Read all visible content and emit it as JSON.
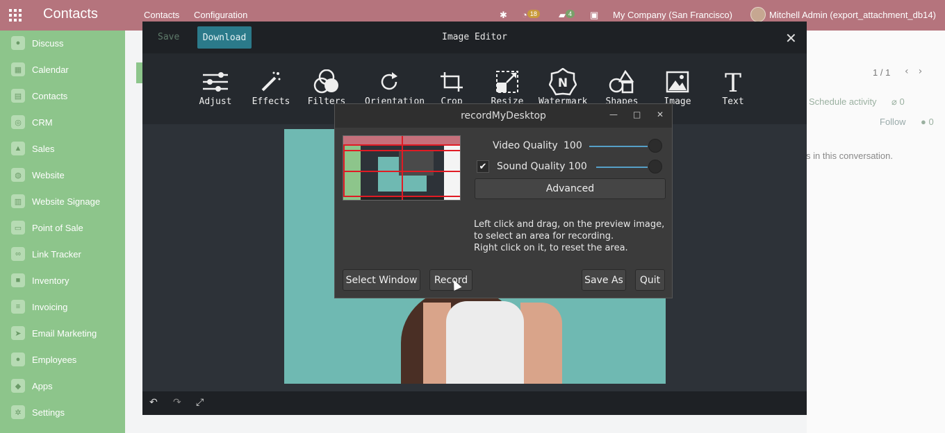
{
  "navbar": {
    "brand": "Contacts",
    "menu": [
      "Contacts",
      "Configuration"
    ],
    "activity_count": "18",
    "message_count": "4",
    "company": "My Company (San Francisco)",
    "user": "Mitchell Admin (export_attachment_db14)"
  },
  "sidebar": {
    "items": [
      {
        "label": "Discuss",
        "icon": "chat-icon"
      },
      {
        "label": "Calendar",
        "icon": "calendar-icon"
      },
      {
        "label": "Contacts",
        "icon": "contacts-icon"
      },
      {
        "label": "CRM",
        "icon": "crm-icon"
      },
      {
        "label": "Sales",
        "icon": "sales-icon"
      },
      {
        "label": "Website",
        "icon": "globe-icon"
      },
      {
        "label": "Website Signage",
        "icon": "signage-icon"
      },
      {
        "label": "Point of Sale",
        "icon": "pos-icon"
      },
      {
        "label": "Link Tracker",
        "icon": "link-icon"
      },
      {
        "label": "Inventory",
        "icon": "box-icon"
      },
      {
        "label": "Invoicing",
        "icon": "invoice-icon"
      },
      {
        "label": "Email Marketing",
        "icon": "send-icon"
      },
      {
        "label": "Employees",
        "icon": "people-icon"
      },
      {
        "label": "Apps",
        "icon": "apps-icon"
      },
      {
        "label": "Settings",
        "icon": "gear-icon"
      }
    ]
  },
  "background": {
    "pager": "1 / 1",
    "schedule_activity": "Schedule activity",
    "attachments": "0",
    "follow": "Follow",
    "followers": "0",
    "conversation_text": "s in this conversation."
  },
  "editor": {
    "save_label": "Save",
    "download_label": "Download",
    "title": "Image Editor",
    "tools": [
      {
        "label": "Adjust"
      },
      {
        "label": "Effects"
      },
      {
        "label": "Filters"
      },
      {
        "label": "Orientation"
      },
      {
        "label": "Crop"
      },
      {
        "label": "Resize"
      },
      {
        "label": "Watermark"
      },
      {
        "label": "Shapes"
      },
      {
        "label": "Image"
      },
      {
        "label": "Text"
      }
    ]
  },
  "rmd": {
    "title": "recordMyDesktop",
    "video_quality_label": "Video Quality",
    "video_quality_value": "100",
    "sound_quality_label": "Sound Quality",
    "sound_quality_value": "100",
    "sound_enabled": true,
    "advanced_label": "Advanced",
    "help_line1": "Left click and drag, on the preview image,",
    "help_line2": "to select an area for recording.",
    "help_line3": "Right click on it, to reset the area.",
    "select_window_label": "Select Window",
    "record_label": "Record",
    "save_as_label": "Save As",
    "quit_label": "Quit"
  },
  "colors": {
    "navbar": "#b5747d",
    "sidebar": "#8dc58b",
    "editor_bg": "#25292e",
    "download_button": "#2b7a8a",
    "slider_accent": "#56a0c8",
    "selection_red": "#e01b24"
  }
}
